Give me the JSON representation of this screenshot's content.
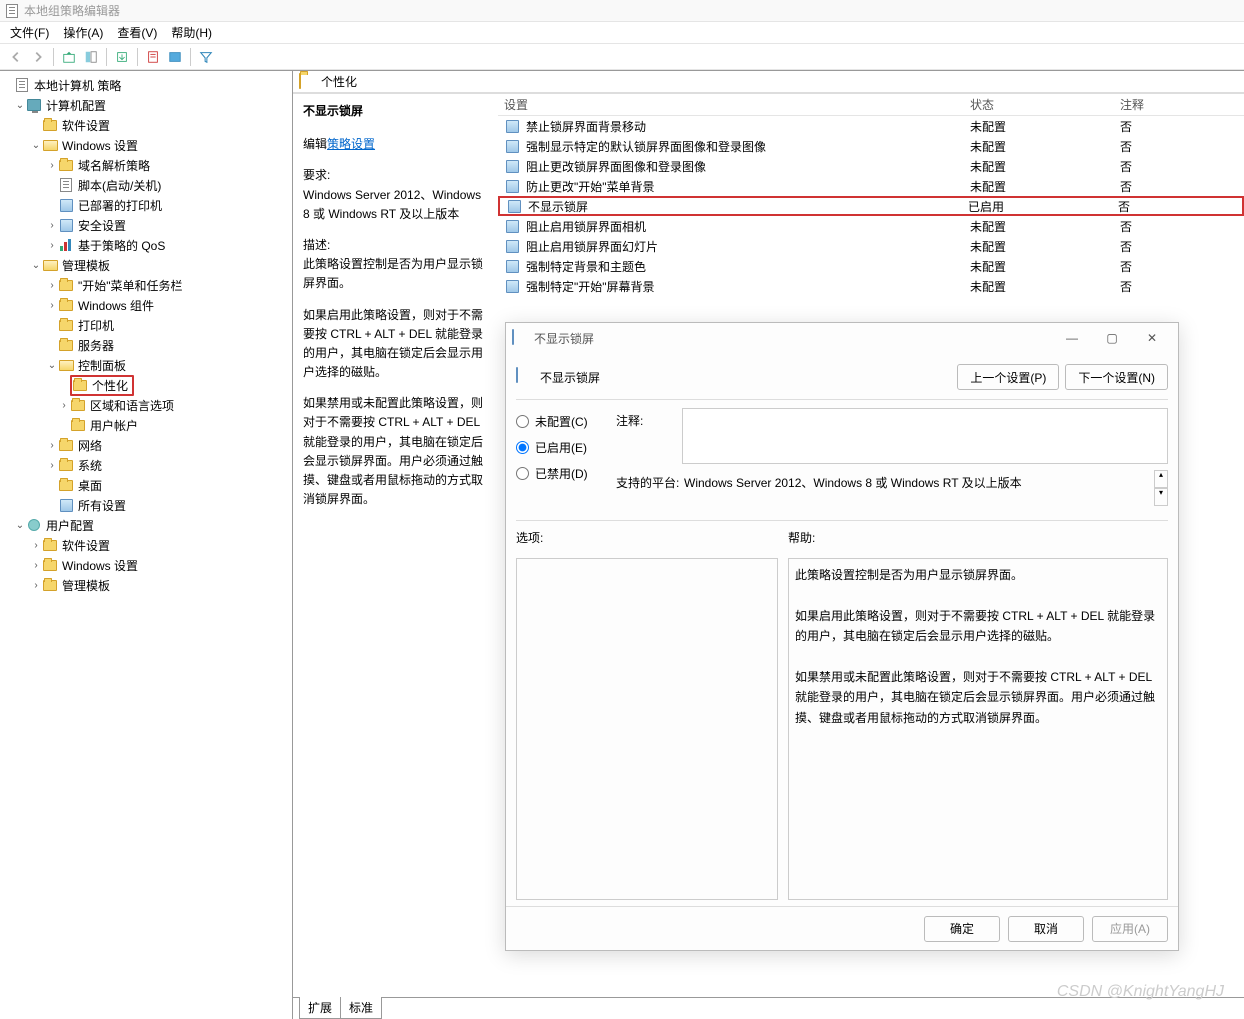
{
  "window": {
    "title": "本地组策略编辑器"
  },
  "menu": {
    "file": "文件(F)",
    "action": "操作(A)",
    "view": "查看(V)",
    "help": "帮助(H)"
  },
  "tree": {
    "root": "本地计算机 策略",
    "computer_config": "计算机配置",
    "software_settings": "软件设置",
    "windows_settings": "Windows 设置",
    "dns_policy": "域名解析策略",
    "scripts": "脚本(启动/关机)",
    "deployed_printers": "已部署的打印机",
    "security_settings": "安全设置",
    "qos": "基于策略的 QoS",
    "admin_templates": "管理模板",
    "start_taskbar": "\"开始\"菜单和任务栏",
    "win_components": "Windows 组件",
    "printers": "打印机",
    "servers": "服务器",
    "control_panel": "控制面板",
    "personalization": "个性化",
    "region_lang": "区域和语言选项",
    "user_accounts": "用户帐户",
    "network": "网络",
    "system": "系统",
    "desktop": "桌面",
    "all_settings": "所有设置",
    "user_config": "用户配置",
    "software_settings2": "软件设置",
    "windows_settings2": "Windows 设置",
    "admin_templates2": "管理模板"
  },
  "content": {
    "header": "个性化",
    "selected_title": "不显示锁屏",
    "edit_link_prefix": "编辑",
    "edit_link": "策略设置",
    "req_label": "要求:",
    "req_text": "Windows Server 2012、Windows 8 或 Windows RT 及以上版本",
    "desc_label": "描述:",
    "desc_text": "此策略设置控制是否为用户显示锁屏界面。",
    "para1": "如果启用此策略设置，则对于不需要按 CTRL + ALT + DEL  就能登录的用户，其电脑在锁定后会显示用户选择的磁贴。",
    "para2": "如果禁用或未配置此策略设置，则对于不需要按 CTRL + ALT + DEL 就能登录的用户，其电脑在锁定后会显示锁屏界面。用户必须通过触摸、键盘或者用鼠标拖动的方式取消锁屏界面。",
    "cols": {
      "setting": "设置",
      "state": "状态",
      "comment": "注释"
    },
    "rows": [
      {
        "name": "禁止锁屏界面背景移动",
        "state": "未配置",
        "comment": "否"
      },
      {
        "name": "强制显示特定的默认锁屏界面图像和登录图像",
        "state": "未配置",
        "comment": "否"
      },
      {
        "name": "阻止更改锁屏界面图像和登录图像",
        "state": "未配置",
        "comment": "否"
      },
      {
        "name": "防止更改\"开始\"菜单背景",
        "state": "未配置",
        "comment": "否"
      },
      {
        "name": "不显示锁屏",
        "state": "已启用",
        "comment": "否",
        "selected": true
      },
      {
        "name": "阻止启用锁屏界面相机",
        "state": "未配置",
        "comment": "否"
      },
      {
        "name": "阻止启用锁屏界面幻灯片",
        "state": "未配置",
        "comment": "否"
      },
      {
        "name": "强制特定背景和主题色",
        "state": "未配置",
        "comment": "否"
      },
      {
        "name": "强制特定\"开始\"屏幕背景",
        "state": "未配置",
        "comment": "否"
      }
    ],
    "tabs": {
      "extended": "扩展",
      "standard": "标准"
    }
  },
  "dialog": {
    "title": "不显示锁屏",
    "name": "不显示锁屏",
    "prev_btn": "上一个设置(P)",
    "next_btn": "下一个设置(N)",
    "radio_notconf": "未配置(C)",
    "radio_enabled": "已启用(E)",
    "radio_disabled": "已禁用(D)",
    "comment_label": "注释:",
    "platform_label": "支持的平台:",
    "platform_text": "Windows Server 2012、Windows 8 或 Windows RT 及以上版本",
    "options_label": "选项:",
    "help_label": "帮助:",
    "help_p1": "此策略设置控制是否为用户显示锁屏界面。",
    "help_p2": "如果启用此策略设置，则对于不需要按 CTRL + ALT + DEL  就能登录的用户，其电脑在锁定后会显示用户选择的磁贴。",
    "help_p3": "如果禁用或未配置此策略设置，则对于不需要按 CTRL + ALT + DEL 就能登录的用户，其电脑在锁定后会显示锁屏界面。用户必须通过触摸、键盘或者用鼠标拖动的方式取消锁屏界面。",
    "ok": "确定",
    "cancel": "取消",
    "apply": "应用(A)"
  },
  "watermark": "CSDN @KnightYangHJ"
}
